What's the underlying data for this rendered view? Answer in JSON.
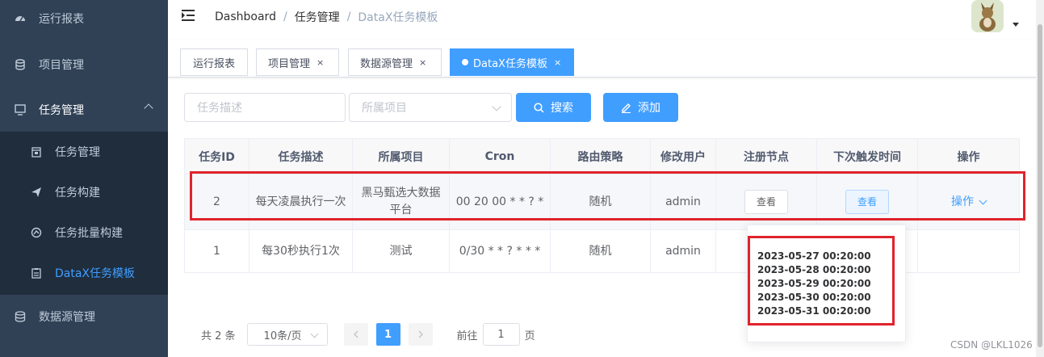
{
  "sidebar": {
    "items": [
      {
        "label": "运行报表",
        "icon": "dashboard-icon"
      },
      {
        "label": "项目管理",
        "icon": "database-icon"
      },
      {
        "label": "任务管理",
        "icon": "monitor-icon"
      },
      {
        "label": "数据源管理",
        "icon": "datasource-icon"
      }
    ],
    "submenu": [
      {
        "label": "任务管理",
        "icon": "calendar-icon"
      },
      {
        "label": "任务构建",
        "icon": "send-icon"
      },
      {
        "label": "任务批量构建",
        "icon": "batch-icon"
      },
      {
        "label": "DataX任务模板",
        "icon": "clipboard-icon"
      }
    ],
    "active_color": "#409eff"
  },
  "breadcrumb": [
    "Dashboard",
    "/",
    "任务管理",
    "/",
    "DataX任务模板"
  ],
  "tags": [
    {
      "label": "运行报表",
      "closable": false
    },
    {
      "label": "项目管理",
      "closable": true
    },
    {
      "label": "数据源管理",
      "closable": true
    },
    {
      "label": "DataX任务模板",
      "closable": true,
      "active": true
    }
  ],
  "tag_close": "×",
  "filters": {
    "desc_placeholder": "任务描述",
    "project_placeholder": "所属项目",
    "search_label": "搜索",
    "add_label": "添加"
  },
  "table": {
    "headers": [
      "任务ID",
      "任务描述",
      "所属项目",
      "Cron",
      "路由策略",
      "修改用户",
      "注册节点",
      "下次触发时间",
      "操作"
    ],
    "rows": [
      {
        "id": "2",
        "desc": "每天凌晨执行一次",
        "project": "黑马甄选大数据平台",
        "cron": "00 20 00 * * ? *",
        "route": "随机",
        "user": "admin",
        "node_btn": "查看",
        "next_btn": "查看",
        "op": "操作"
      },
      {
        "id": "1",
        "desc": "每30秒执行1次",
        "project": "测试",
        "cron": "0/30 * * ? * * *",
        "route": "随机",
        "user": "admin"
      }
    ]
  },
  "popover": {
    "times": [
      "2023-05-27 00:20:00",
      "2023-05-28 00:20:00",
      "2023-05-29 00:20:00",
      "2023-05-30 00:20:00",
      "2023-05-31 00:20:00"
    ]
  },
  "pagination": {
    "total": "共 2 条",
    "page_size": "10条/页",
    "current": "1",
    "goto_prefix": "前往",
    "goto_value": "1",
    "goto_suffix": "页"
  },
  "watermark": "CSDN @LKL1026",
  "colors": {
    "primary": "#409eff",
    "sidebar_bg": "#304156",
    "highlight": "#e0232c"
  }
}
